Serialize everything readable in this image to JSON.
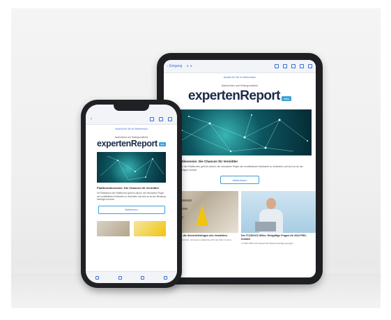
{
  "tablet": {
    "toolbar": {
      "back": "‹ Eingang",
      "nav": "∧ ∨"
    },
    "preheader": "Ansicht für Sie im Webversion",
    "subtitle": "Nachrichten und Hintergrundinfos",
    "brand": "expertenReport",
    "tag": "daily",
    "headline": "Plattformökonomie: Die Chancen für Vermittler",
    "text": "Im Plattformen der Plattformen geht es darum, die relevanten Player am unmittelbaren Netzwerk zu verbinden und sich so an der Beratung beteiligen können.",
    "button": "Weiterlesen",
    "cards": [
      {
        "title": "Sich absichern: die Sicherheitsfragen des Vermittlers",
        "text": "Lorem ipsum dolor sit amet, consetetur sadipscing elitr sed diam nonumy eirmod."
      },
      {
        "title": "Der IT-DSGVO-Office: Endgültige Fragen für 2024 PRO-Kunden",
        "text": "In 2024 Office wird aktuell die Datenschutzlage geregelt."
      }
    ]
  },
  "phone": {
    "preheader": "Ansicht für Sie im Webversion",
    "subtitle": "Nachrichten und Hintergrundinfos",
    "brand": "expertenReport",
    "tag": "daily",
    "headline": "Plattformökonomie: Die Chancen für Vermittler",
    "text": "Im Plattformen der Plattformen geht es darum, die relevanten Player am unmittelbaren Netzwerk zu verbinden und sich so an der Beratung beteiligen können.",
    "button": "Weiterlesen"
  },
  "colors": {
    "accent": "#3aa0d8",
    "brand_text": "#1c2b4a",
    "link": "#3a6fd8",
    "hero_teal": "#0d5660",
    "device": "#1e1f22"
  }
}
